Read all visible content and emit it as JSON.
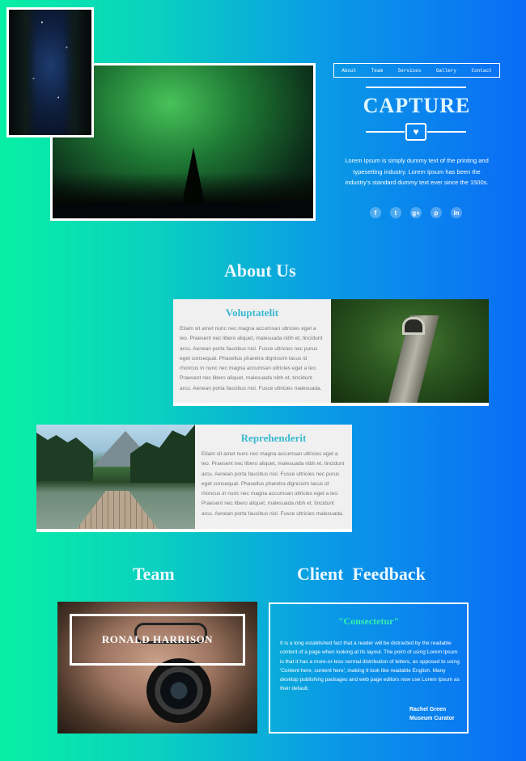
{
  "nav": {
    "items": [
      "About",
      "Team",
      "Services",
      "Gallery",
      "Contact"
    ]
  },
  "brand": {
    "name": "CAPTURE",
    "icon": "camera-heart-icon"
  },
  "intro": "Lorem Ipsum is simply dummy text of the printing and typesetting industry. Lorem Ipsum has been the industry's standard dummy text ever since the 1500s.",
  "social": [
    {
      "icon": "facebook-icon",
      "glyph": "f"
    },
    {
      "icon": "twitter-icon",
      "glyph": "t"
    },
    {
      "icon": "google-plus-icon",
      "glyph": "g+"
    },
    {
      "icon": "pinterest-icon",
      "glyph": "p"
    },
    {
      "icon": "linkedin-icon",
      "glyph": "in"
    }
  ],
  "about": {
    "title": "About Us",
    "cards": [
      {
        "title": "Voluptatelit",
        "text": "Etiam sit amet nunc nec magna accumsan ultricies eget a leo. Praesent nec libero aliquet, malesuada nibh et, tincidunt arcu. Aenean porta faucibus nisl. Fusce ultricies nec purus eget consequat. Phasellus pharetra dignissim lacus id rhoncus in nunc nec magna accumsan ultricies eget a leo. Praesent nec libero aliquet, malesuada nibh et, tincidunt arcu. Aenean porta faucibus nisl. Fusce ultricies malesuada."
      },
      {
        "title": "Reprehenderit",
        "text": "Etiam sit amet nunc nec magna accumsan ultricies eget a leo. Praesent nec libero aliquet, malesuada nibh et, tincidunt arcu. Aenean porta faucibus nisl. Fusce ultricies nec purus eget consequat. Phasellus pharetra dignissim lacus id rhoncus in nunc nec magna accumsan ultricies eget a leo. Praesent nec libero aliquet, malesuada nibh et, tincidunt arcu. Aenean porta faucibus nisl. Fusce ultricies malesuada."
      }
    ]
  },
  "team": {
    "title": "Team",
    "member_name": "RONALD HARRISON"
  },
  "feedback": {
    "title": "Client  Feedback",
    "quote_title": "\"Consectetur\"",
    "text": "It is a long established fact that a reader will be distracted by the readable content of a page when looking at its layout. The point of using Lorem Ipsum is that it has a more-or-less normal distribution of letters, as opposed to using 'Content here, content here', making it look like readable English. Many desktop publishing packages and web page editors now use Lorem Ipsum as their default.",
    "author_name": "Rachel Green",
    "author_role": "Museum Curator"
  }
}
